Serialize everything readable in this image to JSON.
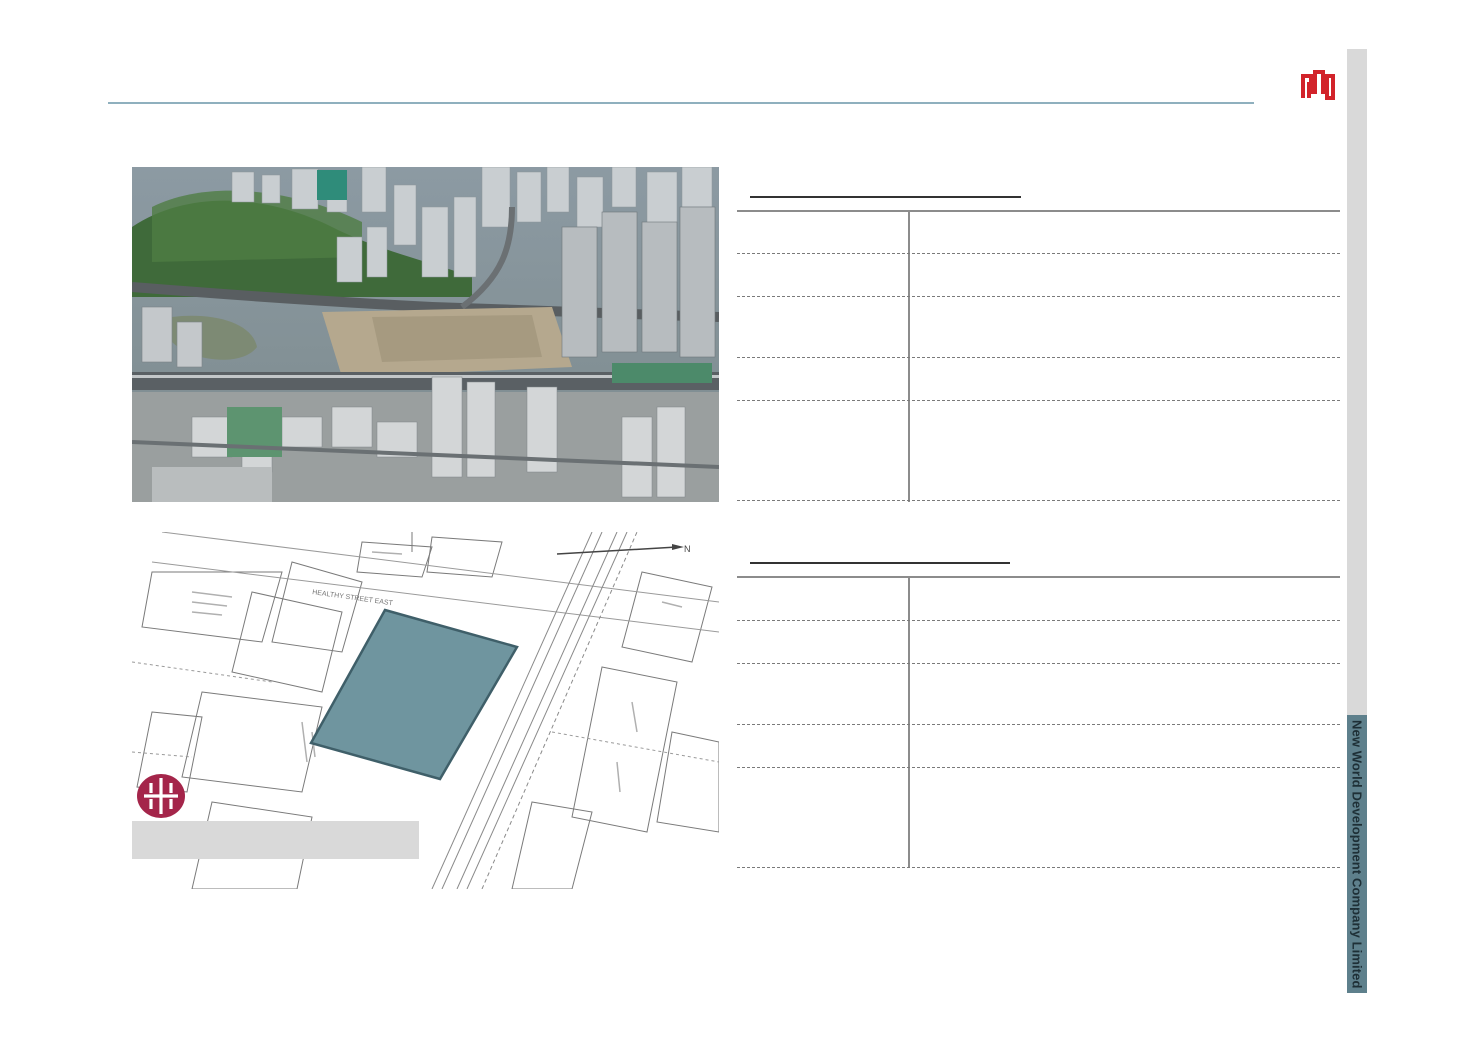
{
  "brand": {
    "company_name": "New World Development Company Limited",
    "logo_icon": "nwd-logo-icon",
    "accent_color": "#d2232a",
    "band_color": "#5e808c",
    "rule_color": "#8fb0be"
  },
  "images": {
    "aerial_photo": "aerial-site-photo",
    "site_plan": "site-plan-map",
    "site_plan_street": "HEALTHY STREET EAST",
    "site_plan_north": "N",
    "transit_logo_icon": "mtr-logo-icon",
    "highlight_color": "#6f959f"
  },
  "tables": [
    {
      "name": "project-details-table-1",
      "rows": 6
    },
    {
      "name": "project-details-table-2",
      "rows": 6
    }
  ]
}
